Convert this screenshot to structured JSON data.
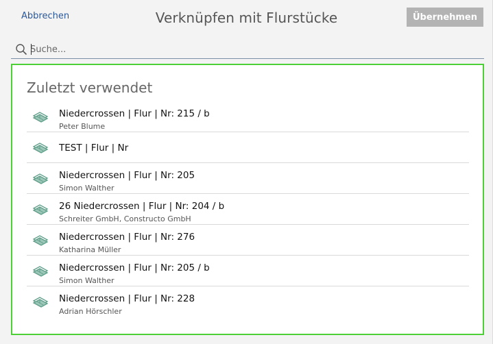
{
  "header": {
    "cancel_label": "Abbrechen",
    "title": "Verknüpfen mit Flurstücke",
    "apply_label": "Übernehmen"
  },
  "search": {
    "placeholder": "Suche...",
    "value": ""
  },
  "recent": {
    "heading": "Zuletzt verwendet",
    "items": [
      {
        "title": "Niedercrossen | Flur | Nr: 215 / b",
        "subtitle": "Peter Blume"
      },
      {
        "title": "TEST | Flur | Nr",
        "subtitle": ""
      },
      {
        "title": "Niedercrossen | Flur | Nr: 205",
        "subtitle": "Simon Walther"
      },
      {
        "title": "26 Niedercrossen | Flur | Nr: 204 / b",
        "subtitle": "Schreiter GmbH, Constructo GmbH"
      },
      {
        "title": "Niedercrossen | Flur | Nr: 276",
        "subtitle": "Katharina Müller"
      },
      {
        "title": "Niedercrossen | Flur | Nr: 205 / b",
        "subtitle": "Simon Walther"
      },
      {
        "title": "Niedercrossen | Flur | Nr: 228",
        "subtitle": "Adrian Hörschler"
      }
    ]
  },
  "colors": {
    "accent_link": "#2b5797",
    "apply_button_bg": "#b3b3b3",
    "panel_border": "#4cd036",
    "icon_color": "#5f9e8a"
  },
  "icons": {
    "search": "search-icon",
    "parcel": "parcel-map-icon"
  }
}
